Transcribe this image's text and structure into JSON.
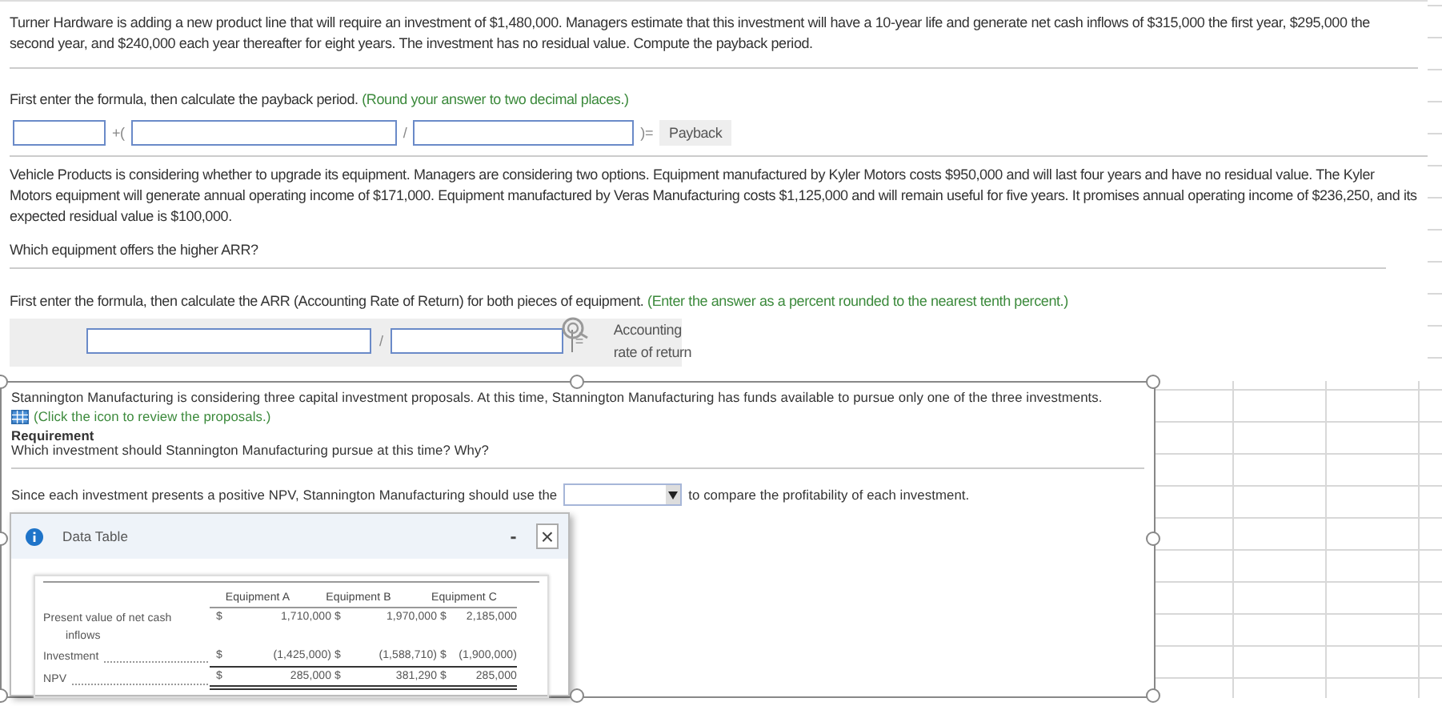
{
  "payback_problem": {
    "prompt": "Turner Hardware is adding a new product line that will require an investment of $1,480,000. Managers estimate that this investment will have a 10-year life and generate net cash inflows of $315,000 the first year, $295,000 the second year, and $240,000 each year thereafter for eight years. The investment has no residual value. Compute the payback period.",
    "instruction": "First enter the formula, then calculate the payback period.",
    "hint": "(Round your answer to two decimal places.)",
    "formula": {
      "plus": "+(",
      "slash": "/",
      "equals": ")=",
      "result": "Payback"
    }
  },
  "arr_problem": {
    "prompt": "Vehicle Products is considering whether to upgrade its equipment. Managers are considering two options. Equipment manufactured by Kyler Motors costs $950,000 and will last four years and have no residual value. The Kyler Motors equipment will generate annual operating income of $171,000. Equipment manufactured by Veras Manufacturing costs $1,125,000 and will remain useful for five years. It promises annual operating income of $236,250, and its expected residual value is $100,000.",
    "question": "Which equipment offers the higher ARR?",
    "instruction": "First enter the formula, then calculate the ARR (Accounting Rate of Return) for both pieces of equipment.",
    "hint": "(Enter the answer as a percent rounded to the nearest tenth percent.)",
    "formula": {
      "slash": "/",
      "equals": "=",
      "result": [
        "Accounting",
        "rate of return"
      ]
    }
  },
  "npv_problem": {
    "prompt": "Stannington Manufacturing is considering three capital investment proposals. At this time, Stannington Manufacturing has funds available to pursue only one of the three investments.",
    "link": "(Click the icon to review the proposals.)",
    "requirement_title": "Requirement",
    "requirement": "Which investment should Stannington Manufacturing pursue at this time? Why?",
    "sentence_start": "Since each investment presents a positive NPV, Stannington Manufacturing should use the",
    "sentence_end": "to compare the profitability of each investment.",
    "data_table": {
      "title": "Data Table",
      "minimize": "-",
      "close": "×",
      "columns": [
        "Equipment A",
        "Equipment B",
        "Equipment C"
      ],
      "rows": [
        {
          "label": "Present value of net cash inflows",
          "cells": [
            "$",
            "1,710,000 $",
            "1,970,000 $",
            "2,185,000"
          ]
        },
        {
          "label": "Investment",
          "cells": [
            "$",
            "(1,425,000) $",
            "(1,588,710) $",
            "(1,900,000)"
          ]
        },
        {
          "label": "NPV",
          "cells": [
            "$",
            "285,000 $",
            "381,290 $",
            "285,000"
          ]
        }
      ]
    }
  }
}
